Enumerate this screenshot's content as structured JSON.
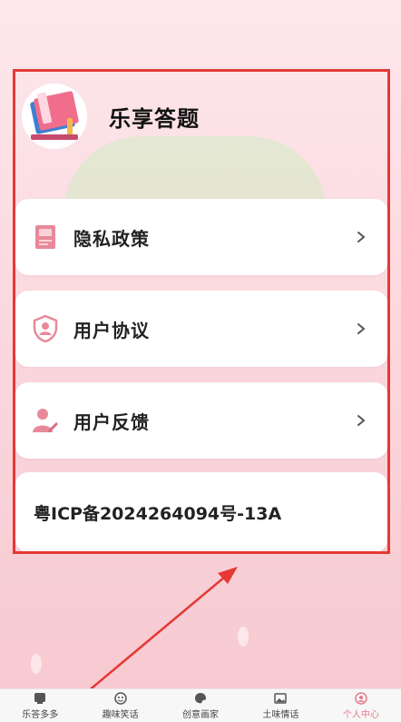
{
  "app": {
    "name": "乐享答题"
  },
  "menu": [
    {
      "label": "隐私政策",
      "icon": "document-icon"
    },
    {
      "label": "用户协议",
      "icon": "shield-user-icon"
    },
    {
      "label": "用户反馈",
      "icon": "user-edit-icon"
    }
  ],
  "icp": {
    "text": "粤ICP备2024264094号-13A"
  },
  "tabs": [
    {
      "label": "乐答多多",
      "icon": "quiz-icon",
      "active": false
    },
    {
      "label": "趣味笑话",
      "icon": "smile-icon",
      "active": false
    },
    {
      "label": "创意画家",
      "icon": "palette-icon",
      "active": false
    },
    {
      "label": "土味情话",
      "icon": "image-icon",
      "active": false
    },
    {
      "label": "个人中心",
      "icon": "user-icon",
      "active": true
    }
  ],
  "colors": {
    "accent": "#e57a8c",
    "highlight": "#e53935",
    "icon": "#e8899a"
  }
}
